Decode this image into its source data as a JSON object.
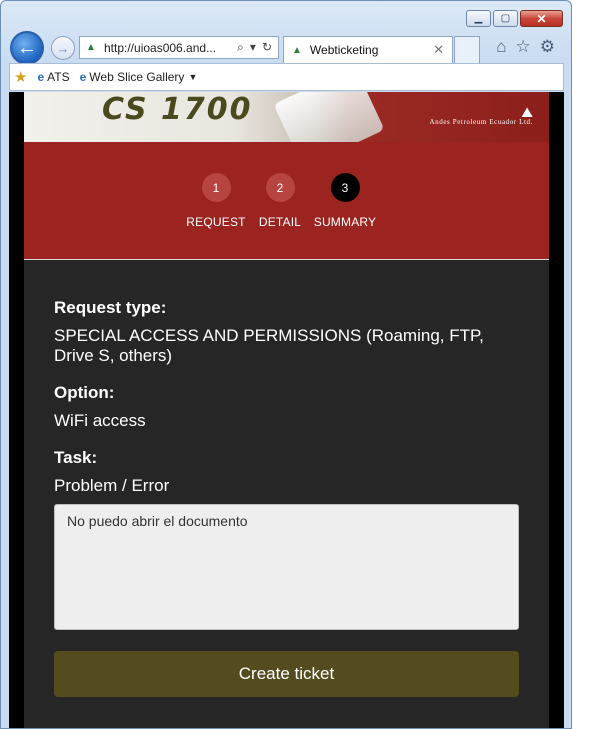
{
  "browser": {
    "address_url": "http://uioas006.and...",
    "tab_title": "Webticketing",
    "favorites_bar": {
      "items": [
        {
          "label": "ATS"
        },
        {
          "label": "Web Slice Gallery"
        }
      ]
    }
  },
  "banner": {
    "product_logo": "CS 1700",
    "company_name": "Andes Petroleum Ecuador Ltd."
  },
  "steps": [
    {
      "number": "1",
      "label": "REQUEST",
      "active": false
    },
    {
      "number": "2",
      "label": "DETAIL",
      "active": false
    },
    {
      "number": "3",
      "label": "SUMMARY",
      "active": true
    }
  ],
  "summary": {
    "request_type_label": "Request type:",
    "request_type_value": "SPECIAL ACCESS AND PERMISSIONS (Roaming, FTP, Drive S, others)",
    "option_label": "Option:",
    "option_value": "WiFi access",
    "task_label": "Task:",
    "task_value": "Problem / Error",
    "description_value": "No puedo abrir el documento"
  },
  "actions": {
    "create_ticket_label": "Create ticket"
  },
  "colors": {
    "steps_panel": "#9b2320",
    "content_bg": "#262626",
    "create_button": "#544c1f"
  }
}
